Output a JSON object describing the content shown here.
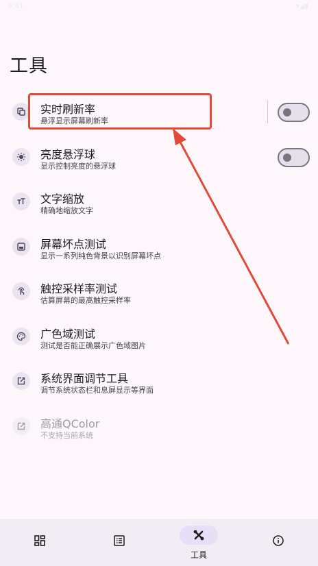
{
  "status": {
    "time": "9:41",
    "icons": "▾◢▮"
  },
  "page": {
    "title": "工具"
  },
  "tools": [
    {
      "title": "实时刷新率",
      "subtitle": "悬浮显示屏幕刷新率",
      "icon": "layers-icon",
      "toggle": false,
      "enabled": true
    },
    {
      "title": "亮度悬浮球",
      "subtitle": "显示控制亮度的悬浮球",
      "icon": "brightness-icon",
      "toggle": false,
      "enabled": true
    },
    {
      "title": "文字缩放",
      "subtitle": "精确地缩放文字",
      "icon": "text-size-icon",
      "enabled": true
    },
    {
      "title": "屏幕坏点测试",
      "subtitle": "显示一系列纯色背景以识别屏幕坏点",
      "icon": "screen-test-icon",
      "enabled": true
    },
    {
      "title": "触控采样率测试",
      "subtitle": "估算屏幕的最高触控采样率",
      "icon": "touch-icon",
      "enabled": true
    },
    {
      "title": "广色域测试",
      "subtitle": "测试是否能正确展示广色域图片",
      "icon": "palette-icon",
      "enabled": true
    },
    {
      "title": "系统界面调节工具",
      "subtitle": "调节系统状态栏和息屏显示等界面",
      "icon": "open-external-icon",
      "enabled": true
    },
    {
      "title": "高通QColor",
      "subtitle": "不支持当前系统",
      "icon": "open-external-icon",
      "enabled": false
    }
  ],
  "nav": {
    "items": [
      {
        "label": "",
        "icon": "dashboard-icon",
        "active": false
      },
      {
        "label": "",
        "icon": "list-icon",
        "active": false
      },
      {
        "label": "工具",
        "icon": "tools-icon",
        "active": true
      },
      {
        "label": "",
        "icon": "info-icon",
        "active": false
      }
    ]
  },
  "colors": {
    "accent": "#e8def8",
    "annotation": "#e04a36",
    "background": "#fdf7fc"
  }
}
